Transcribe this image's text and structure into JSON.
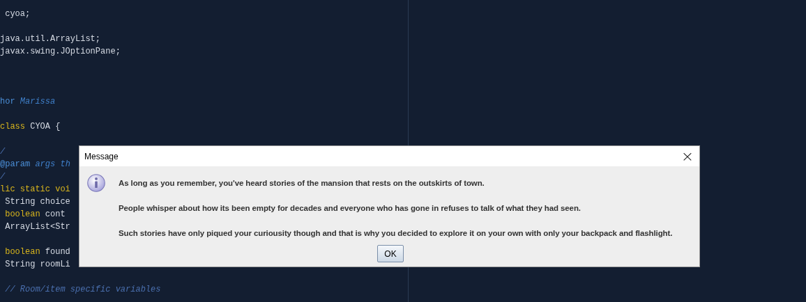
{
  "editor": {
    "lines": [
      {
        "kind": "code",
        "tokens": [
          {
            "kind": "plain",
            "text": " cyoa;"
          }
        ]
      },
      {
        "kind": "blank"
      },
      {
        "kind": "code",
        "tokens": [
          {
            "kind": "plain",
            "text": "java.util.ArrayList;"
          }
        ]
      },
      {
        "kind": "code",
        "tokens": [
          {
            "kind": "plain",
            "text": "javax.swing.JOptionPane;"
          }
        ]
      },
      {
        "kind": "blank"
      },
      {
        "kind": "blank"
      },
      {
        "kind": "blank"
      },
      {
        "kind": "code",
        "tokens": [
          {
            "kind": "tag",
            "text": "hor "
          },
          {
            "kind": "italic",
            "text": "Marissa"
          }
        ]
      },
      {
        "kind": "blank"
      },
      {
        "kind": "code",
        "tokens": [
          {
            "kind": "keyword",
            "text": "class"
          },
          {
            "kind": "plain",
            "text": " CYOA {"
          }
        ]
      },
      {
        "kind": "blank"
      },
      {
        "kind": "code",
        "tokens": [
          {
            "kind": "comment",
            "text": "/"
          }
        ]
      },
      {
        "kind": "code",
        "tokens": [
          {
            "kind": "tag",
            "text": "@param "
          },
          {
            "kind": "italic",
            "text": "args th"
          }
        ]
      },
      {
        "kind": "code",
        "tokens": [
          {
            "kind": "comment",
            "text": "/"
          }
        ]
      },
      {
        "kind": "code",
        "tokens": [
          {
            "kind": "keyword",
            "text": "lic static voi"
          }
        ]
      },
      {
        "kind": "code",
        "tokens": [
          {
            "kind": "plain",
            "text": " String choice"
          }
        ]
      },
      {
        "kind": "code",
        "tokens": [
          {
            "kind": "keyword",
            "text": " boolean"
          },
          {
            "kind": "plain",
            "text": " cont"
          }
        ]
      },
      {
        "kind": "code",
        "tokens": [
          {
            "kind": "plain",
            "text": " ArrayList<Str"
          }
        ]
      },
      {
        "kind": "blank"
      },
      {
        "kind": "code",
        "tokens": [
          {
            "kind": "keyword",
            "text": " boolean"
          },
          {
            "kind": "plain",
            "text": " found"
          }
        ]
      },
      {
        "kind": "code",
        "tokens": [
          {
            "kind": "plain",
            "text": " String roomLi"
          }
        ]
      },
      {
        "kind": "blank"
      },
      {
        "kind": "code",
        "tokens": [
          {
            "kind": "comment",
            "text": " // Room/item specific variables"
          }
        ]
      }
    ]
  },
  "dialog": {
    "title": "Message",
    "close": "×",
    "message": [
      "As long as you remember, you've heard stories of the mansion that rests on the outskirts of town.",
      "People whisper about how its been empty for decades and everyone who has gone in refuses to talk of what they had seen.",
      "Such stories have only  piqued your curiousity though and that is why you decided to explore it on your own with only your backpack and flashlight."
    ],
    "buttons": [
      "OK"
    ]
  }
}
